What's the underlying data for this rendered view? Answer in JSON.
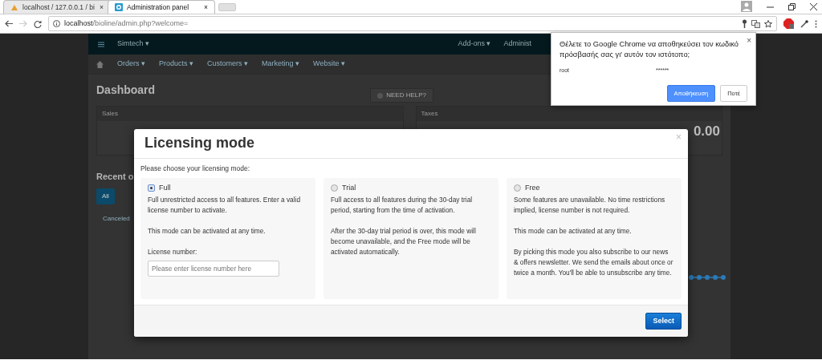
{
  "browser": {
    "tabs": [
      {
        "label": "localhost / 127.0.0.1 / bi",
        "selected": false,
        "close": "×"
      },
      {
        "label": "Administration panel",
        "selected": true,
        "close": "×"
      }
    ],
    "address": {
      "host": "localhost",
      "path": "/bioline/admin.php?welcome="
    }
  },
  "admin": {
    "top_nav": {
      "brand": "Simtech ▾",
      "items": [
        "Add-ons ▾",
        "Administ"
      ]
    },
    "menu": [
      "Orders ▾",
      "Products ▾",
      "Customers ▾",
      "Marketing ▾",
      "Website ▾"
    ],
    "page_title": "Dashboard",
    "help": "NEED HELP?",
    "panels": [
      {
        "title": "Sales"
      },
      {
        "title": "Taxes",
        "value": "0.00"
      }
    ],
    "recent_title": "Recent o",
    "filter": "All",
    "status": "Canceled"
  },
  "modal": {
    "title": "Licensing mode",
    "close": "×",
    "prompt": "Please choose your licensing mode:",
    "modes": [
      {
        "label": "Full",
        "selected": true,
        "kind": "license",
        "paragraphs": [
          "Full unrestricted access to all features.  Enter a valid license number to activate.",
          "This mode can be activated at any time."
        ],
        "field_label": "License number:",
        "placeholder": "Please enter license number here"
      },
      {
        "label": "Trial",
        "selected": false,
        "kind": "plain",
        "paragraphs": [
          "Full access to all features during the 30-day trial period, starting from the time of activation.",
          "After the 30-day trial period is over, this mode will become unavailable, and the Free mode will be activated automatically."
        ]
      },
      {
        "label": "Free",
        "selected": false,
        "kind": "plain",
        "paragraphs": [
          "Some features are unavailable. No time restrictions implied, license number is not required.",
          "This mode can be activated at any time.",
          "By picking this mode you also subscribe to our news & offers newsletter. We send the emails about once or twice a month. You'll be able to unsubscribe any time."
        ]
      }
    ],
    "button": "Select"
  },
  "password_prompt": {
    "message": "Θέλετε το Google Chrome να αποθηκεύσει τον κωδικό πρόσβασής σας γι' αυτόν τον ιστότοπο;",
    "username": "root",
    "password": "******",
    "close": "×",
    "buttons": [
      {
        "label": "Αποθήκευση",
        "kind": "primary"
      },
      {
        "label": "Ποτέ",
        "kind": "secondary"
      }
    ]
  }
}
